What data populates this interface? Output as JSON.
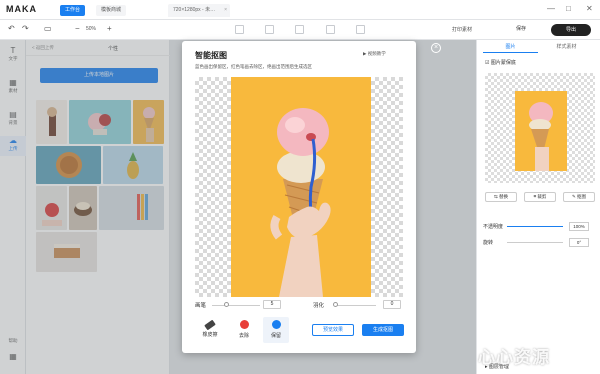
{
  "app": {
    "logo": "MAKA",
    "tabs": [
      {
        "label": "工作台"
      },
      {
        "label": "模板商城"
      }
    ],
    "doc_tab": "720×1280px - 未…",
    "win_controls": {
      "minimize": "—",
      "maximize": "□",
      "close": "✕"
    }
  },
  "toolbar": {
    "zoom": "50%",
    "minus": "−",
    "plus": "+",
    "save": "保存",
    "export": "导出",
    "print": "打印素材"
  },
  "rail": [
    {
      "icon": "T",
      "label": "文字"
    },
    {
      "icon": "▦",
      "label": "素材"
    },
    {
      "icon": "▤",
      "label": "背景"
    },
    {
      "icon": "☁",
      "label": "上传"
    }
  ],
  "rail_bottom": {
    "help": "帮助"
  },
  "left_panel": {
    "back": "< 返回上传",
    "title": "个性",
    "upload_button": "上传本地图片"
  },
  "modal": {
    "title": "智能抠图",
    "description": "蓝色画出保留区，红色笔画去除区，绝画出范围后生成选区",
    "video_link": "视频教学",
    "brush_label": "画笔",
    "brush_value": "5",
    "feather_label": "羽化",
    "feather_value": "0",
    "tools": [
      {
        "label": "橡皮擦",
        "color": "#444444"
      },
      {
        "label": "去除",
        "color": "#e8403a"
      },
      {
        "label": "保留",
        "color": "#1a7ff0"
      }
    ],
    "preview_button": "预览效果",
    "generate_button": "生成抠图"
  },
  "right_panel": {
    "tabs": [
      {
        "label": "图片"
      },
      {
        "label": "样式素材"
      }
    ],
    "checkbox_label": "图片蒙保底",
    "buttons": [
      {
        "label": "替换"
      },
      {
        "label": "裁剪"
      },
      {
        "label": "抠图"
      }
    ],
    "opacity_label": "不透明度",
    "opacity_value": "100%",
    "rotate_label": "旋转",
    "rotate_value": "0°",
    "bottom_label": "图层管理"
  },
  "watermark": "心心资源",
  "colors": {
    "accent": "#1a7ff0",
    "photo_bg": "#f8b93d"
  }
}
